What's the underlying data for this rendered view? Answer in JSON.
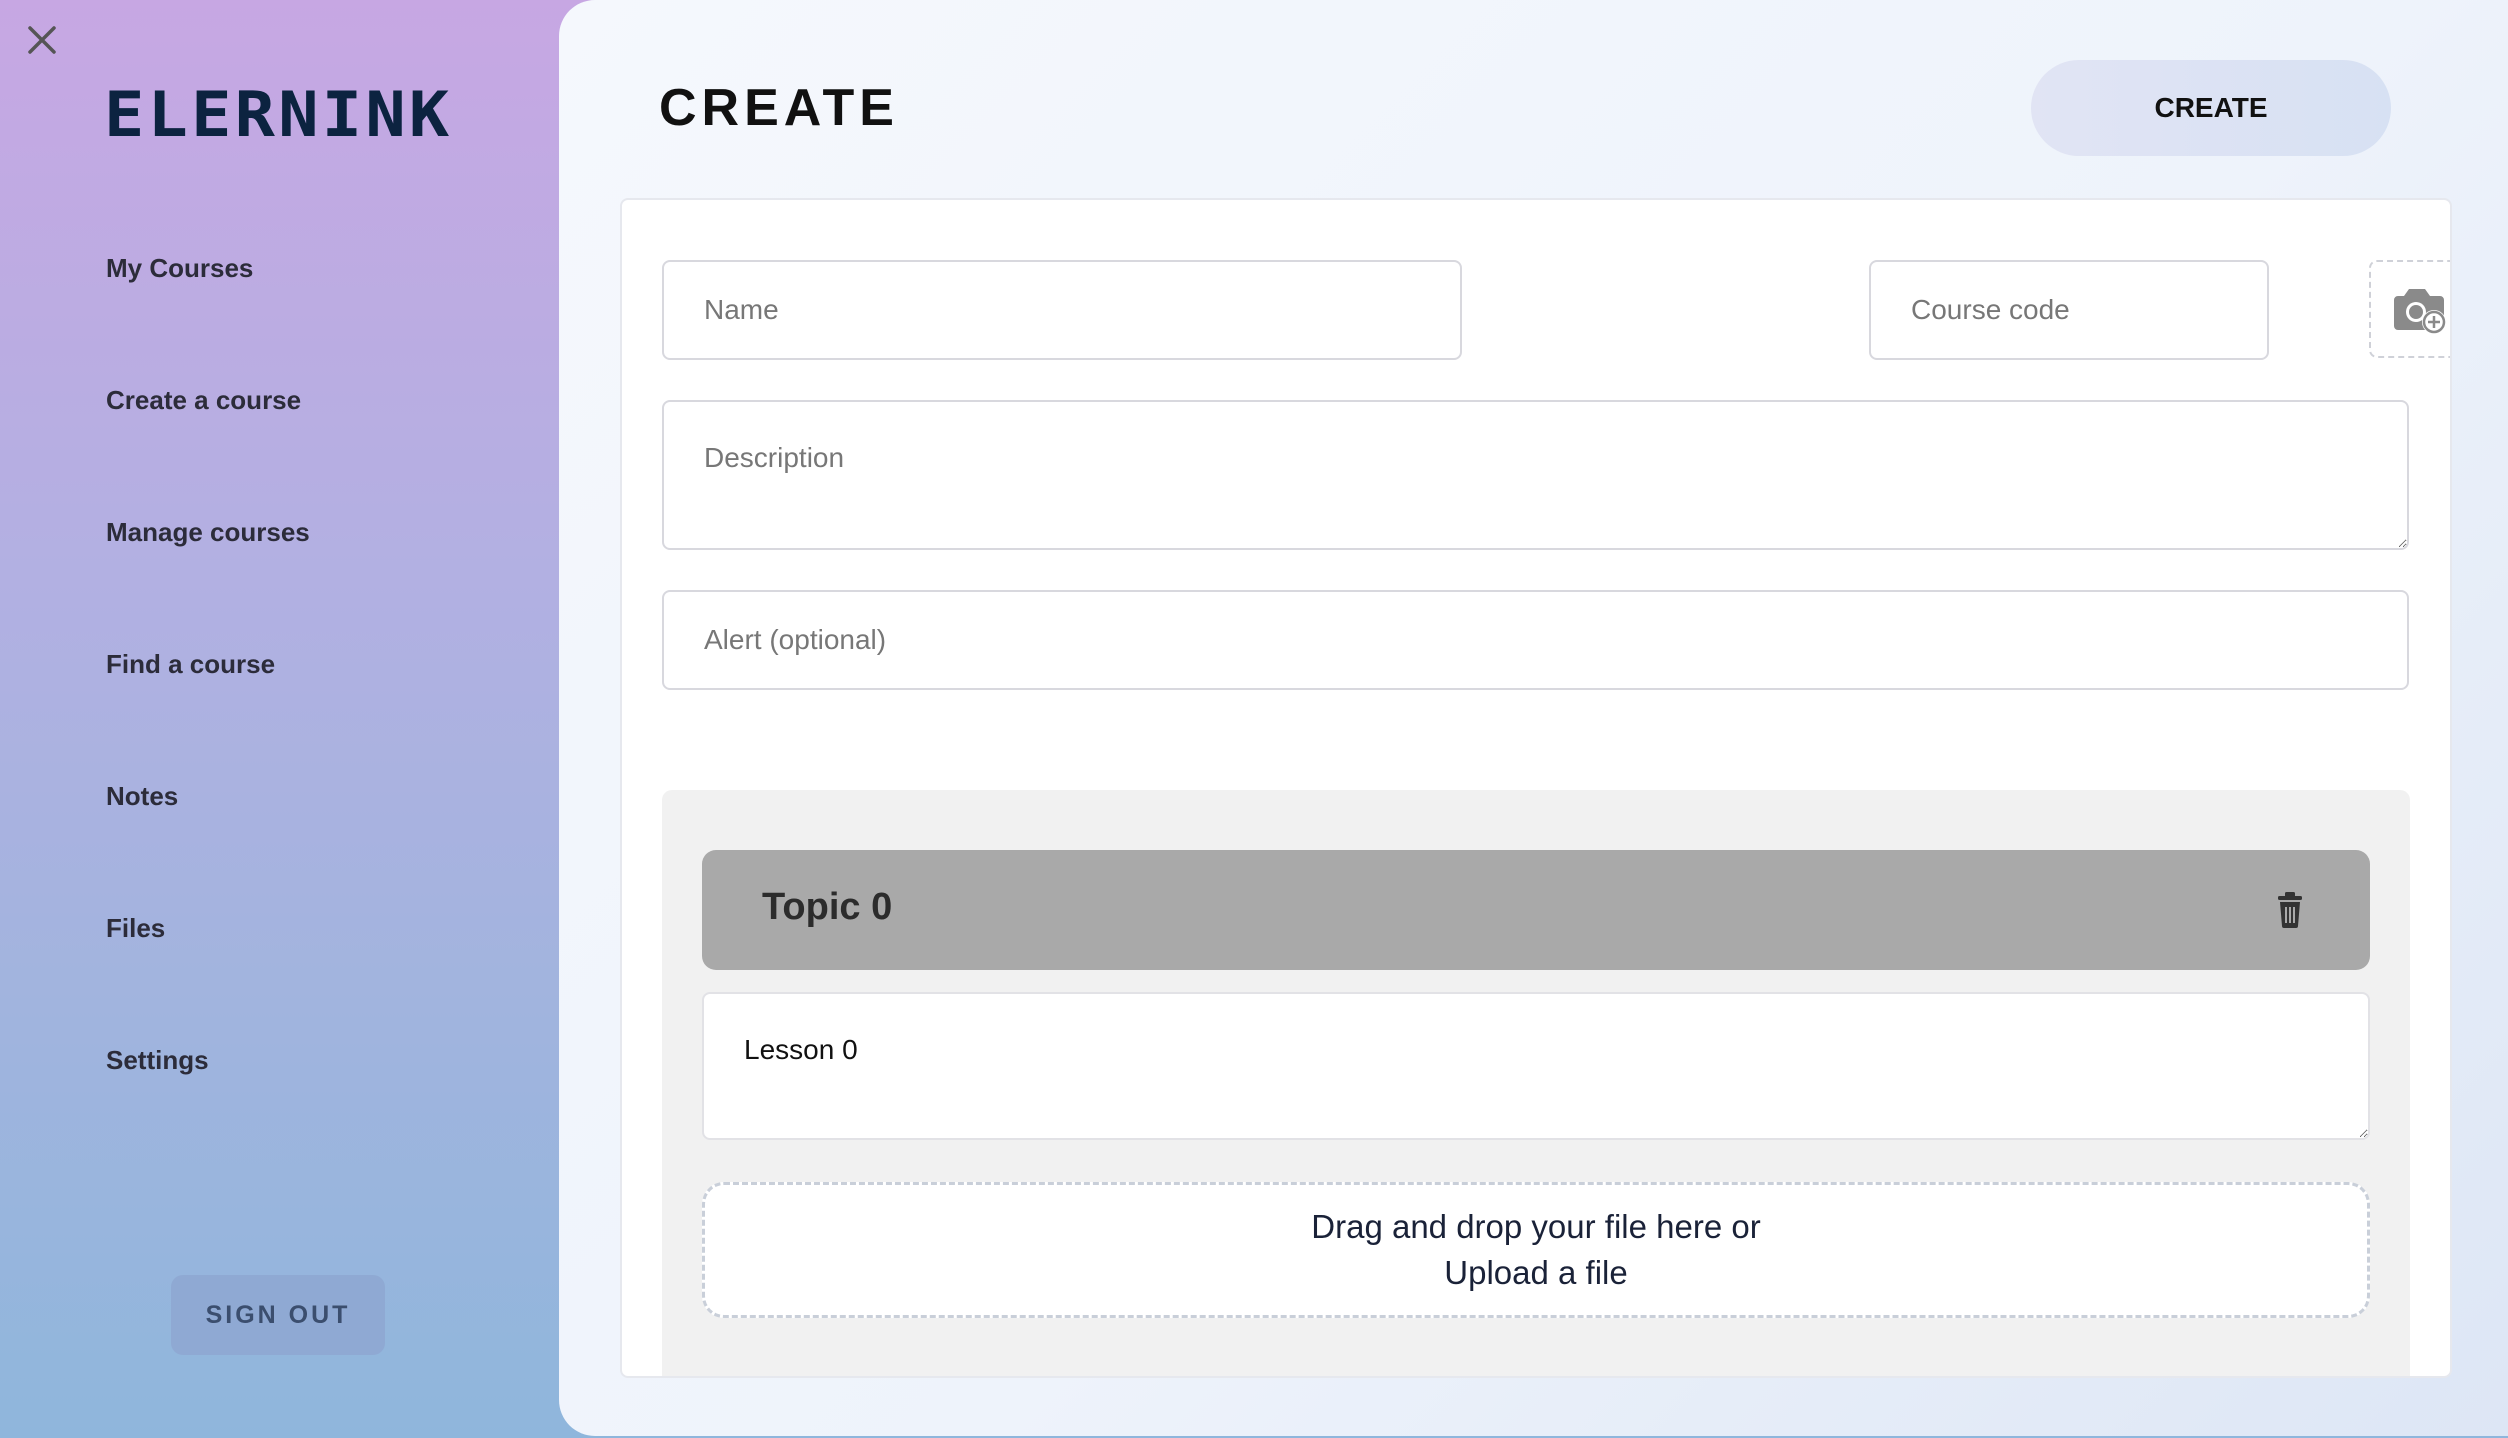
{
  "sidebar": {
    "logo": "ELERNINK",
    "nav": [
      {
        "label": "My Courses"
      },
      {
        "label": "Create a course"
      },
      {
        "label": "Manage courses"
      },
      {
        "label": "Find a course"
      },
      {
        "label": "Notes"
      },
      {
        "label": "Files"
      },
      {
        "label": "Settings"
      }
    ],
    "signout_label": "SIGN OUT"
  },
  "header": {
    "title": "CREATE",
    "create_button": "CREATE"
  },
  "form": {
    "name_placeholder": "Name",
    "course_code_placeholder": "Course code",
    "description_placeholder": "Description",
    "alert_placeholder": "Alert (optional)",
    "photo_icon": "camera-plus-icon"
  },
  "topic": {
    "title": "Topic 0",
    "delete_icon": "trash-icon",
    "lesson_value": "Lesson 0",
    "dropzone_line1": "Drag and drop your file here or",
    "dropzone_link": "Upload a file"
  },
  "colors": {
    "logo": "#0c2340",
    "topic_header": "#a9a9a9",
    "signout_bg": "#8fa9d3"
  }
}
